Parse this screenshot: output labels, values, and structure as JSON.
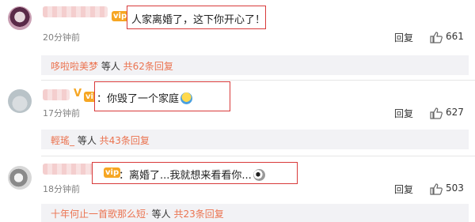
{
  "comments": [
    {
      "text": "人家离婚了，这下你开心了！",
      "time": "20分钟前",
      "reply_label": "回复",
      "likes": "661",
      "reply_bar": {
        "name": "哆啦啦美梦",
        "middle": " 等人 ",
        "count": "共62条回复"
      }
    },
    {
      "text": "：你毁了一个家庭",
      "time": "17分钟前",
      "reply_label": "回复",
      "likes": "627",
      "reply_bar": {
        "name": "輕瑤_",
        "middle": " 等人 ",
        "count": "共43条回复"
      }
    },
    {
      "text": "：离婚了...我就想来看看你...",
      "time": "18分钟前",
      "reply_label": "回复",
      "likes": "503",
      "reply_bar": {
        "name": "十年何止一首歌那么短·",
        "middle": " 等人 ",
        "count": "共23条回复"
      }
    }
  ],
  "icons": {
    "like": "thumbs-up-icon",
    "vip": "vip-badge-icon",
    "emoji_1": "hug-emoji-icon",
    "emoji_2": "staring-emoji-icon"
  },
  "colors": {
    "highlight_box": "#d83a3a",
    "reply_name": "#eb7350",
    "reply_bg": "#f2f2f5",
    "vip": "#f6a623"
  },
  "badges": {
    "vip_1": "vip",
    "verified_2": "V"
  }
}
